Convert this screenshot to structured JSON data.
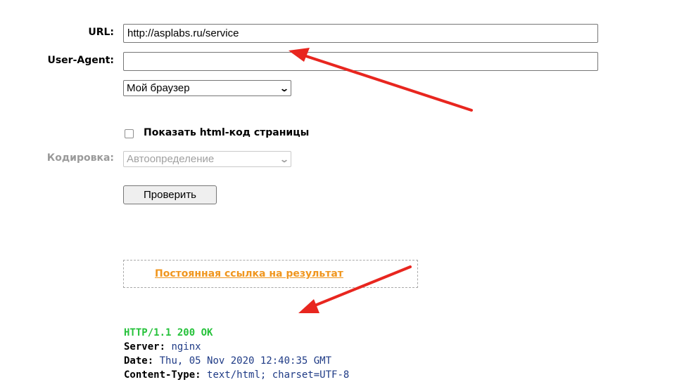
{
  "form": {
    "url_label": "URL:",
    "url_value": "http://asplabs.ru/service",
    "useragent_label": "User-Agent:",
    "useragent_value": "",
    "browser_select_value": "Мой браузер",
    "show_html_label": "Показать html-код страницы",
    "encoding_label": "Кодировка:",
    "encoding_select_value": "Автоопределение",
    "check_button_label": "Проверить"
  },
  "result": {
    "permalink_label": "Постоянная ссылка на результат",
    "status_line": "HTTP/1.1 200 OK",
    "headers": [
      {
        "key": "Server:",
        "value": "nginx"
      },
      {
        "key": "Date:",
        "value": "Thu, 05 Nov 2020 12:40:35 GMT"
      },
      {
        "key": "Content-Type:",
        "value": "text/html; charset=UTF-8"
      }
    ]
  },
  "colors": {
    "status": "#26c23b",
    "header_value": "#1f3b86",
    "permalink": "#f0961e",
    "annotation_arrow": "#e8261f"
  }
}
